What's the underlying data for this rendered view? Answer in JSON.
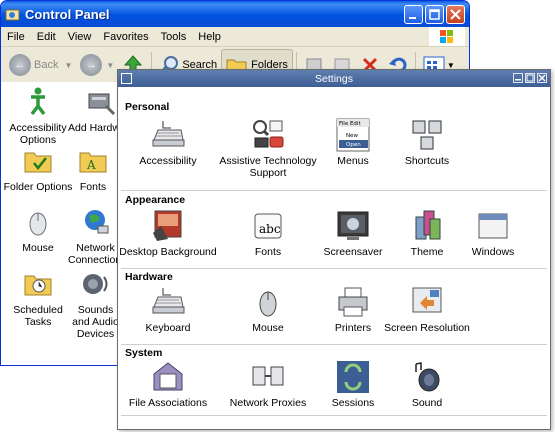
{
  "xp_window": {
    "title": "Control Panel",
    "menu": [
      "File",
      "Edit",
      "View",
      "Favorites",
      "Tools",
      "Help"
    ],
    "toolbar": {
      "back": "Back",
      "search": "Search",
      "folders": "Folders"
    },
    "items": [
      {
        "label": "Accessibility Options",
        "icon": "accessibility-icon"
      },
      {
        "label": "Add Hardware",
        "icon": "add-hardware-icon"
      },
      {
        "label": "Folder Options",
        "icon": "folder-options-icon"
      },
      {
        "label": "Fonts",
        "icon": "fonts-folder-icon"
      },
      {
        "label": "Mouse",
        "icon": "mouse-icon"
      },
      {
        "label": "Network Connections",
        "icon": "network-icon"
      },
      {
        "label": "Scheduled Tasks",
        "icon": "scheduled-tasks-icon"
      },
      {
        "label": "Sounds and Audio Devices",
        "icon": "sounds-icon"
      }
    ]
  },
  "settings_window": {
    "title": "Settings",
    "sections": [
      {
        "title": "Personal",
        "items": [
          {
            "label": "Accessibility",
            "icon": "keyboard-access-icon"
          },
          {
            "label": "Assistive Technology Support",
            "icon": "assistive-tech-icon"
          },
          {
            "label": "Menus",
            "icon": "menus-icon"
          },
          {
            "label": "Shortcuts",
            "icon": "shortcuts-icon"
          }
        ]
      },
      {
        "title": "Appearance",
        "items": [
          {
            "label": "Desktop Background",
            "icon": "desktop-background-icon"
          },
          {
            "label": "Fonts",
            "icon": "fonts-icon"
          },
          {
            "label": "Screensaver",
            "icon": "screensaver-icon"
          },
          {
            "label": "Theme",
            "icon": "theme-icon"
          },
          {
            "label": "Windows",
            "icon": "windows-icon"
          }
        ]
      },
      {
        "title": "Hardware",
        "items": [
          {
            "label": "Keyboard",
            "icon": "keyboard-icon"
          },
          {
            "label": "Mouse",
            "icon": "mouse-icon"
          },
          {
            "label": "Printers",
            "icon": "printer-icon"
          },
          {
            "label": "Screen Resolution",
            "icon": "screen-resolution-icon"
          }
        ]
      },
      {
        "title": "System",
        "items": [
          {
            "label": "File Associations",
            "icon": "file-associations-icon"
          },
          {
            "label": "Network Proxies",
            "icon": "network-proxies-icon"
          },
          {
            "label": "Sessions",
            "icon": "sessions-icon"
          },
          {
            "label": "Sound",
            "icon": "sound-icon"
          }
        ]
      }
    ],
    "menus_icon_text": [
      "File Edit",
      "New",
      "Open"
    ],
    "fonts_icon_text": "abc"
  }
}
